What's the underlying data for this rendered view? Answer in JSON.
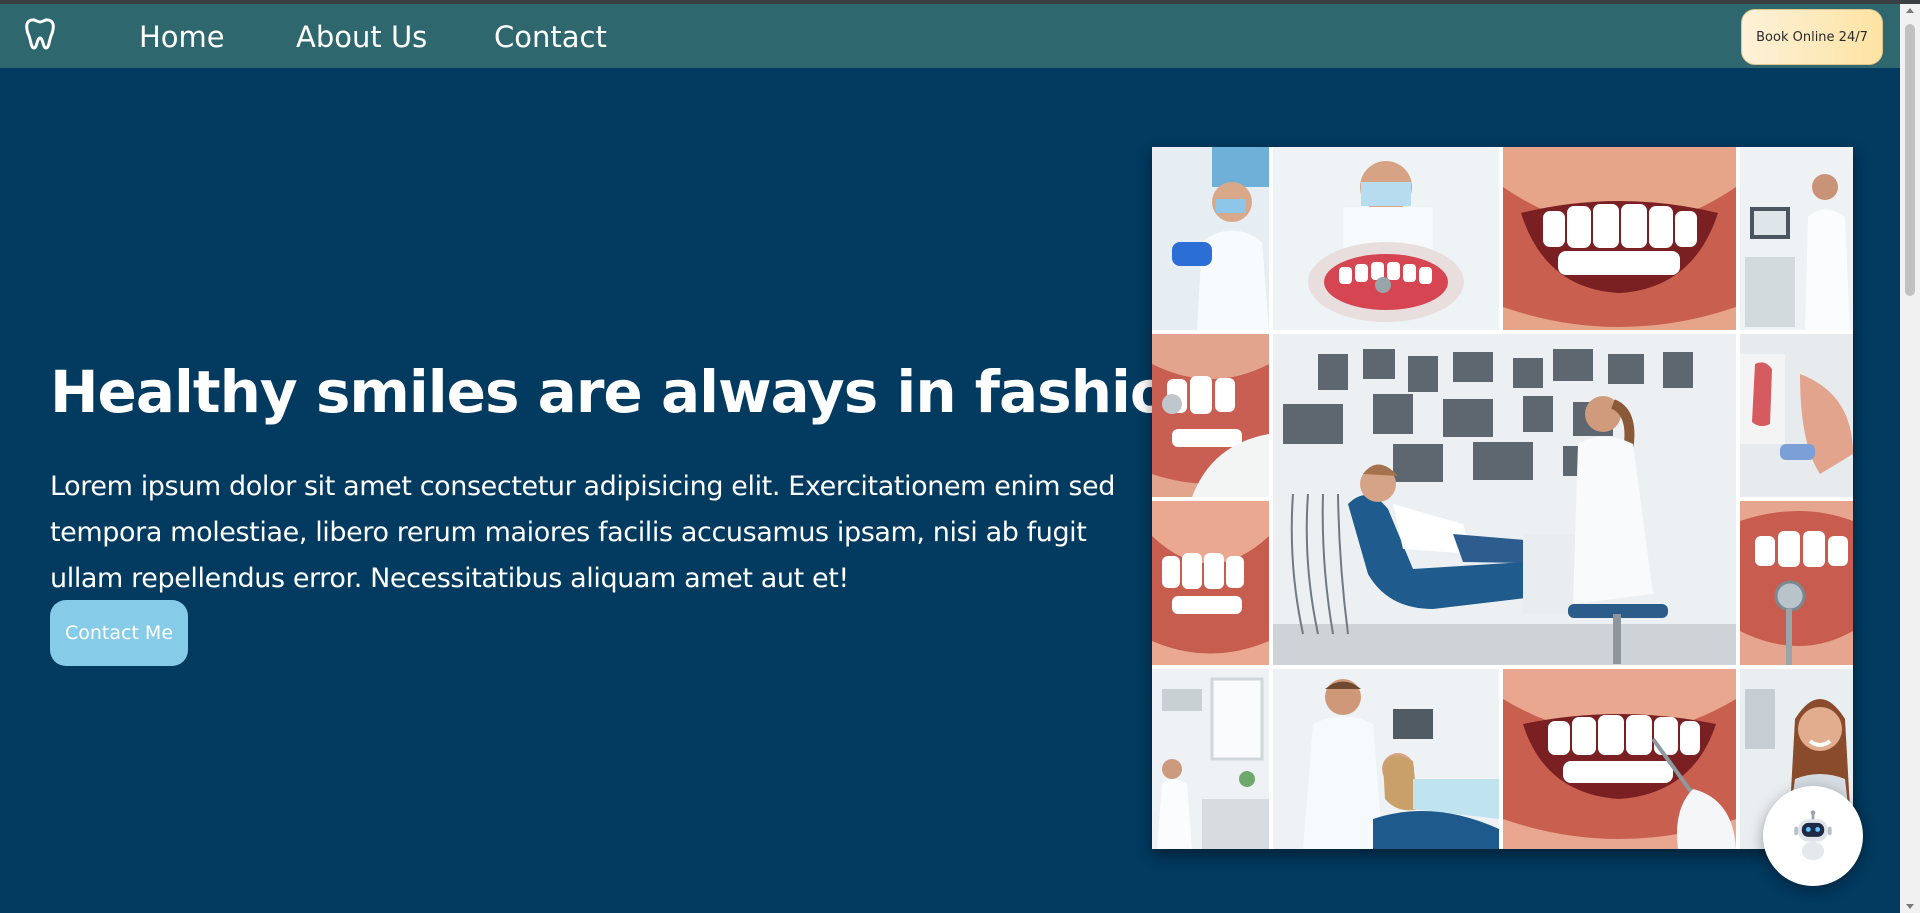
{
  "nav": {
    "logo_icon": "tooth-icon",
    "links": [
      "Home",
      "About Us",
      "Contact"
    ],
    "book_label": "Book Online 24/7"
  },
  "hero": {
    "title": "Healthy smiles are always in fashion",
    "text": "Lorem ipsum dolor sit amet consectetur adipisicing elit. Exercitationem enim sed tempora molestiae, libero rerum maiores facilis accusamus ipsam, nisi ab fugit ullam repellendus error. Necessitatibus aliquam amet aut et!",
    "button_label": "Contact Me"
  },
  "collage": {
    "tiles": [
      "dentist-at-work",
      "dental-model-exam",
      "white-smile",
      "dentist-with-monitor",
      "mirror-on-teeth",
      "patient-in-dental-chair",
      "gum-model",
      "white-smile",
      "dental-mirror",
      "dentist-office",
      "dentist-with-patient",
      "smile-with-tool",
      "smiling-woman"
    ]
  },
  "chat": {
    "icon": "robot-chat-icon"
  },
  "colors": {
    "page_bg": "#023a60",
    "navbar_bg": "#2e676d",
    "contact_button": "#86cbe8",
    "book_button": "#fde3a3"
  }
}
